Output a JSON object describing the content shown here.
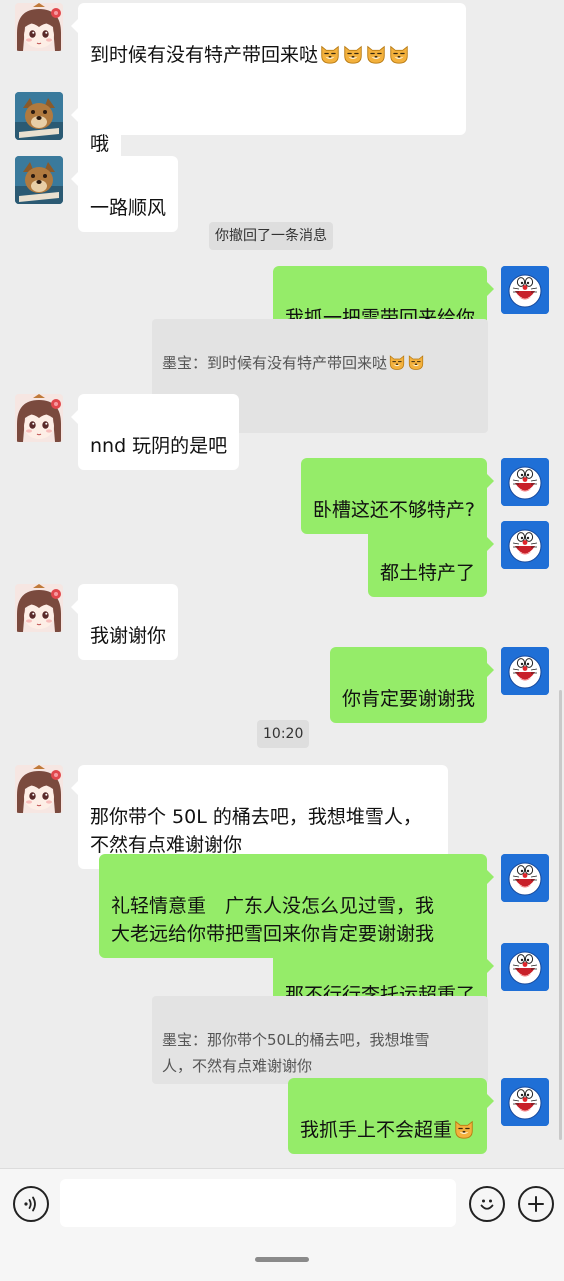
{
  "messages": {
    "m1": {
      "text": "到时候有没有特产带回来哒",
      "emojis_line1": [
        "dog-face-emoji",
        "dog-face-emoji",
        "dog-face-emoji",
        "dog-face-emoji"
      ],
      "emojis_line2": [
        "dog-face-emoji"
      ]
    },
    "m2": {
      "text": "哦"
    },
    "m3": {
      "text": "一路顺风"
    },
    "sys1": "你撤回了一条消息",
    "m4": {
      "text": "我抓一把雪带回来给你"
    },
    "quote1": {
      "text": "墨宝：到时候有没有特产带回来哒"
    },
    "m5": {
      "text": "nnd 玩阴的是吧"
    },
    "m6": {
      "text": "卧槽这还不够特产?"
    },
    "m7": {
      "text": "都土特产了"
    },
    "m8": {
      "text": "我谢谢你"
    },
    "m9": {
      "text": "你肯定要谢谢我"
    },
    "time1": "10:20",
    "m10": {
      "text": "那你带个 50L 的桶去吧，我想堆雪人，\n不然有点难谢谢你"
    },
    "m11": {
      "text": "礼轻情意重　广东人没怎么见过雪，我\n大老远给你带把雪回来你肯定要谢谢我"
    },
    "m12": {
      "text": "那不行行李托运超重了"
    },
    "quote2": {
      "text": "墨宝：那你带个50L的桶去吧，我想堆雪\n人，不然有点难谢谢你"
    },
    "m13": {
      "text": "我抓手上不会超重"
    }
  },
  "input": {
    "placeholder": "",
    "value": ""
  },
  "icons": {
    "voice": "voice-icon",
    "emoji": "smiley-icon",
    "plus": "plus-icon"
  },
  "colors": {
    "background": "#ededed",
    "outgoing_bubble": "#95ec69",
    "incoming_bubble": "#ffffff",
    "my_avatar": "#1f6fd6"
  }
}
